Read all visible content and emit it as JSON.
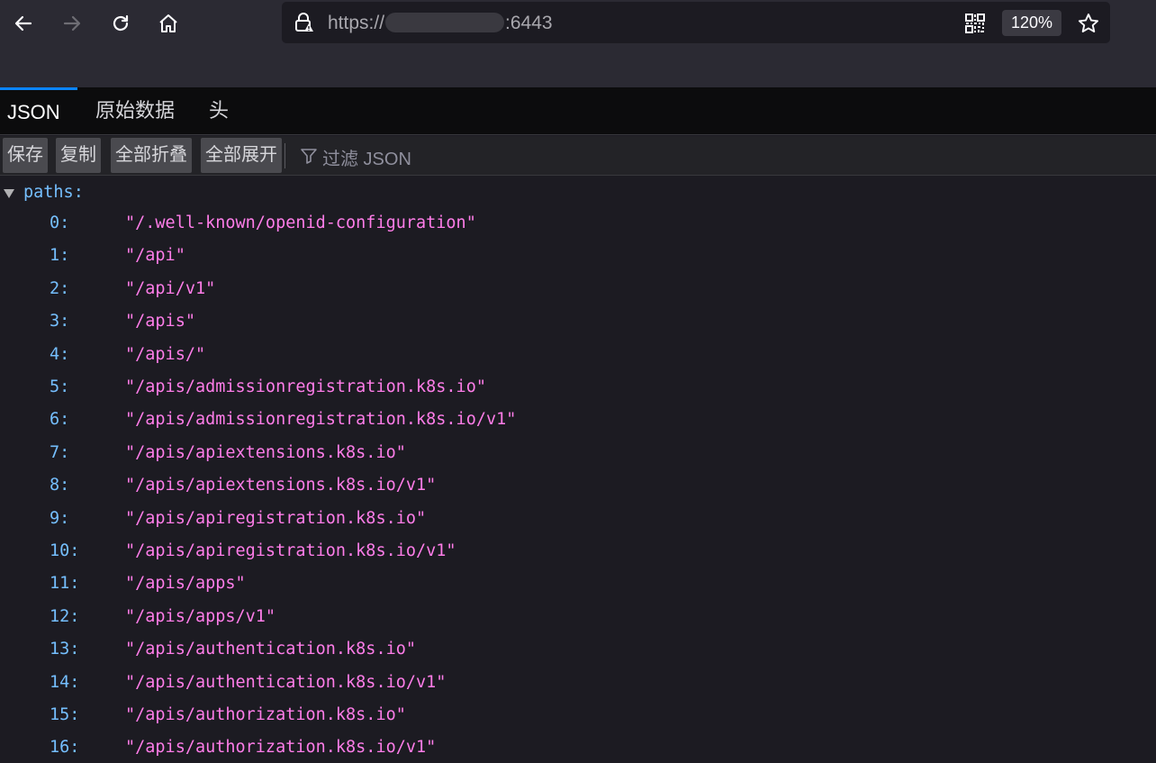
{
  "browser": {
    "url_prefix": "https://",
    "url_suffix": ":6443",
    "zoom": "120%"
  },
  "tabs": [
    {
      "label": "JSON",
      "active": true
    },
    {
      "label": "原始数据",
      "active": false
    },
    {
      "label": "头",
      "active": false
    }
  ],
  "toolbar": {
    "save_label": "保存",
    "copy_label": "复制",
    "collapse_all_label": "全部折叠",
    "expand_all_label": "全部展开",
    "filter_placeholder": "过滤 JSON"
  },
  "json_view": {
    "root_key": "paths:",
    "items": [
      {
        "key": "0:",
        "value": "\"/.well-known/openid-configuration\""
      },
      {
        "key": "1:",
        "value": "\"/api\""
      },
      {
        "key": "2:",
        "value": "\"/api/v1\""
      },
      {
        "key": "3:",
        "value": "\"/apis\""
      },
      {
        "key": "4:",
        "value": "\"/apis/\""
      },
      {
        "key": "5:",
        "value": "\"/apis/admissionregistration.k8s.io\""
      },
      {
        "key": "6:",
        "value": "\"/apis/admissionregistration.k8s.io/v1\""
      },
      {
        "key": "7:",
        "value": "\"/apis/apiextensions.k8s.io\""
      },
      {
        "key": "8:",
        "value": "\"/apis/apiextensions.k8s.io/v1\""
      },
      {
        "key": "9:",
        "value": "\"/apis/apiregistration.k8s.io\""
      },
      {
        "key": "10:",
        "value": "\"/apis/apiregistration.k8s.io/v1\""
      },
      {
        "key": "11:",
        "value": "\"/apis/apps\""
      },
      {
        "key": "12:",
        "value": "\"/apis/apps/v1\""
      },
      {
        "key": "13:",
        "value": "\"/apis/authentication.k8s.io\""
      },
      {
        "key": "14:",
        "value": "\"/apis/authentication.k8s.io/v1\""
      },
      {
        "key": "15:",
        "value": "\"/apis/authorization.k8s.io\""
      },
      {
        "key": "16:",
        "value": "\"/apis/authorization.k8s.io/v1\""
      }
    ]
  },
  "colors": {
    "key": "#75bfff",
    "string": "#ff7de9",
    "accent": "#0a84ff"
  }
}
